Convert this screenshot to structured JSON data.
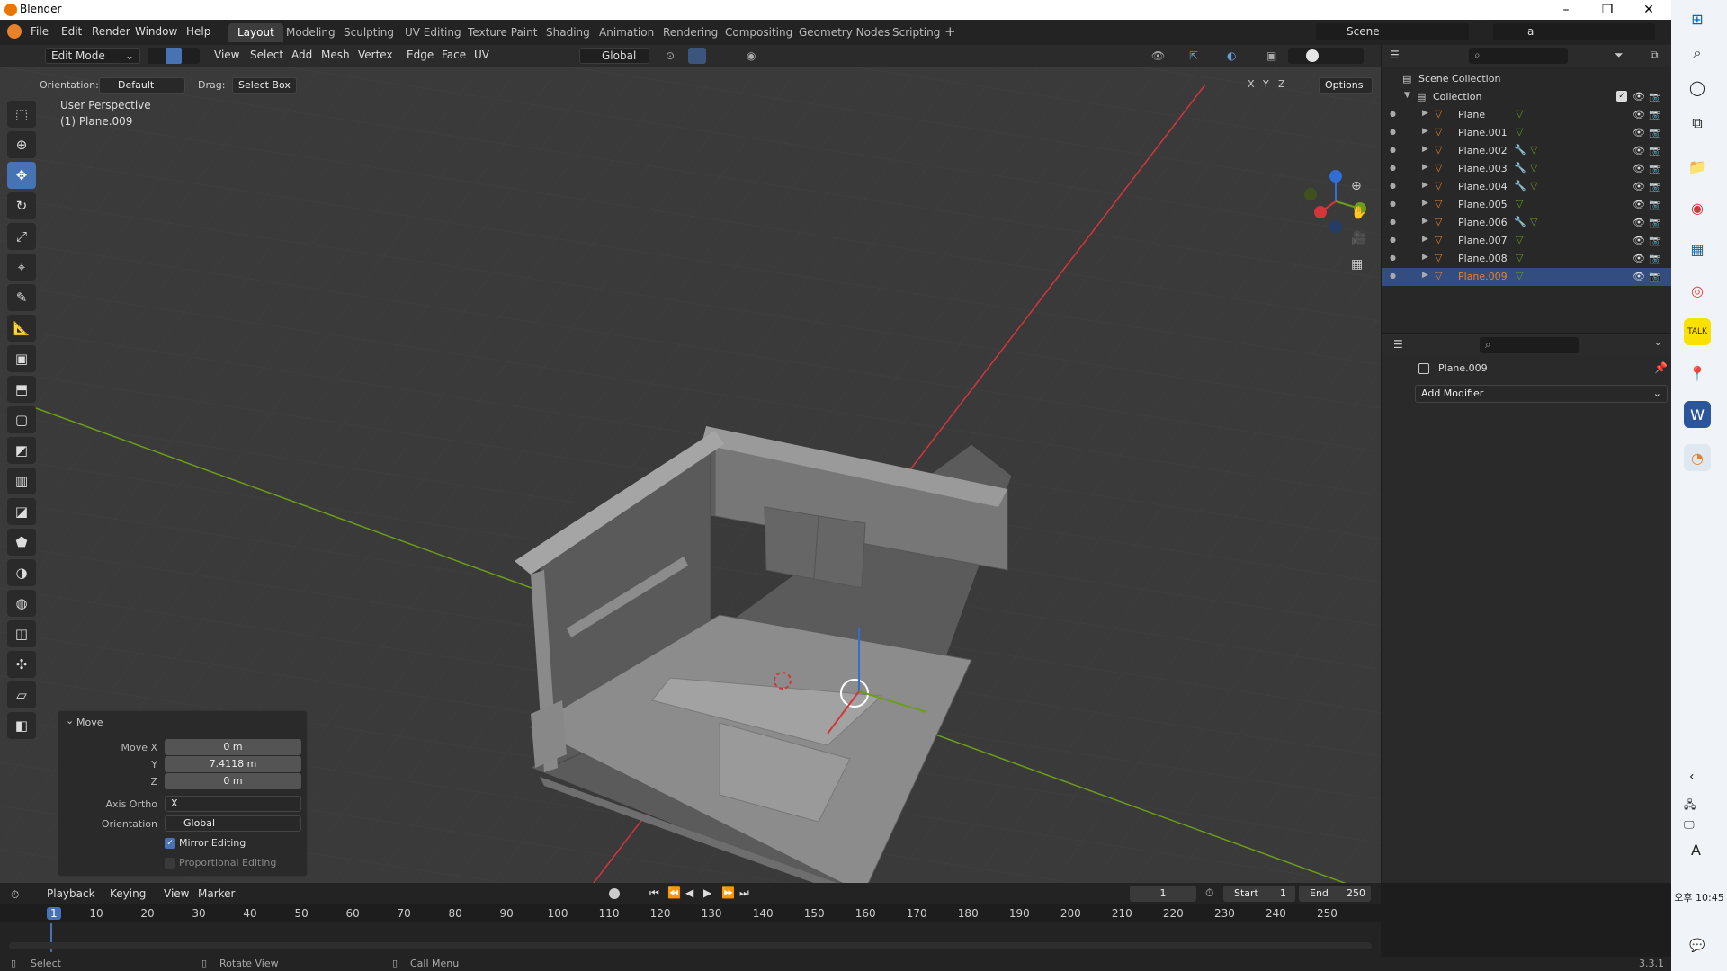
{
  "window": {
    "title": "Blender",
    "controls": [
      "–",
      "❐",
      "✕"
    ]
  },
  "menu": [
    "File",
    "Edit",
    "Render",
    "Window",
    "Help"
  ],
  "workspaces": [
    {
      "label": "Layout",
      "active": true
    },
    {
      "label": "Modeling"
    },
    {
      "label": "Sculpting"
    },
    {
      "label": "UV Editing"
    },
    {
      "label": "Texture Paint"
    },
    {
      "label": "Shading"
    },
    {
      "label": "Animation"
    },
    {
      "label": "Rendering"
    },
    {
      "label": "Compositing"
    },
    {
      "label": "Geometry Nodes"
    },
    {
      "label": "Scripting"
    }
  ],
  "scene": {
    "label": "Scene",
    "viewlayer": "a"
  },
  "viewport_header": {
    "mode": "Edit Mode",
    "menus": [
      "View",
      "Select",
      "Add",
      "Mesh",
      "Vertex",
      "Edge",
      "Face",
      "UV"
    ],
    "transform": "Global",
    "orientation_label": "Orientation:",
    "orientation": "Default",
    "drag_label": "Drag:",
    "drag": "Select Box",
    "axes": [
      "X",
      "Y",
      "Z"
    ],
    "options": "Options"
  },
  "viewport": {
    "perspective": "User Perspective",
    "object": "(1) Plane.009"
  },
  "operator_panel": {
    "title": "Move",
    "fields": [
      {
        "label": "Move X",
        "value": "0 m"
      },
      {
        "label": "Y",
        "value": "7.4118 m"
      },
      {
        "label": "Z",
        "value": "0 m"
      }
    ],
    "axis_ortho_label": "Axis Ortho",
    "axis_ortho": "X",
    "orientation_label": "Orientation",
    "orientation": "Global",
    "mirror_editing": "Mirror Editing",
    "proportional_editing": "Proportional Editing"
  },
  "outliner": {
    "root": "Scene Collection",
    "collection": "Collection",
    "items": [
      {
        "name": "Plane",
        "mod": false
      },
      {
        "name": "Plane.001",
        "mod": false
      },
      {
        "name": "Plane.002",
        "mod": true
      },
      {
        "name": "Plane.003",
        "mod": true
      },
      {
        "name": "Plane.004",
        "mod": true
      },
      {
        "name": "Plane.005",
        "mod": false
      },
      {
        "name": "Plane.006",
        "mod": true
      },
      {
        "name": "Plane.007",
        "mod": false
      },
      {
        "name": "Plane.008",
        "mod": false
      },
      {
        "name": "Plane.009",
        "mod": false,
        "selected": true
      }
    ]
  },
  "properties": {
    "object": "Plane.009",
    "add_modifier": "Add Modifier"
  },
  "timeline": {
    "menus": [
      "Playback",
      "Keying",
      "View",
      "Marker"
    ],
    "current_frame": "1",
    "start_label": "Start",
    "start": "1",
    "end_label": "End",
    "end": "250",
    "ticks": [
      "1",
      "10",
      "20",
      "30",
      "40",
      "50",
      "60",
      "70",
      "80",
      "90",
      "100",
      "110",
      "120",
      "130",
      "140",
      "150",
      "160",
      "170",
      "180",
      "190",
      "200",
      "210",
      "220",
      "230",
      "240",
      "250"
    ]
  },
  "statusbar": {
    "select": "Select",
    "rotate": "Rotate View",
    "call_menu": "Call Menu",
    "version": "3.3.1"
  },
  "taskbar": {
    "time": "오후 10:45",
    "input": "A"
  },
  "colors": {
    "accent": "#4772b3",
    "selected_row": "#334d80",
    "orange": "#e8822a",
    "x_axis": "#d4353b",
    "y_axis": "#6a9d1a",
    "z_axis": "#2f6ed5"
  }
}
